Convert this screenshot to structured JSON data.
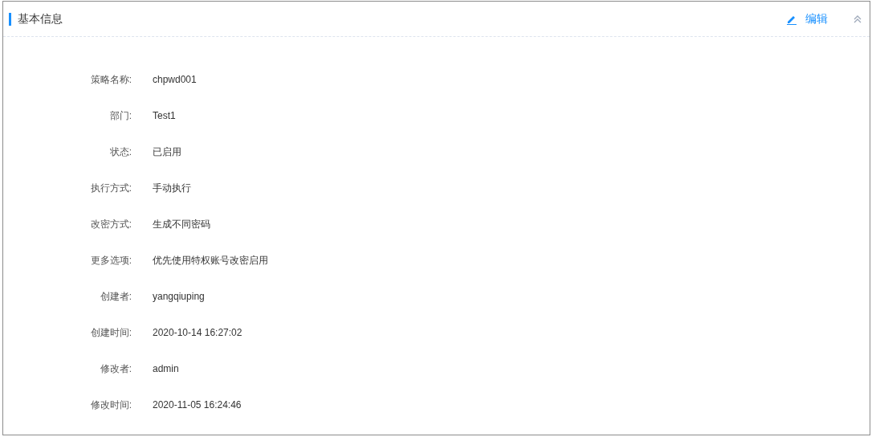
{
  "section": {
    "title": "基本信息",
    "edit_label": "编辑",
    "collapsed": false
  },
  "fields": [
    {
      "label": "策略名称:",
      "value": "chpwd001"
    },
    {
      "label": "部门:",
      "value": "Test1"
    },
    {
      "label": "状态:",
      "value": "已启用"
    },
    {
      "label": "执行方式:",
      "value": "手动执行"
    },
    {
      "label": "改密方式:",
      "value": "生成不同密码"
    },
    {
      "label": "更多选项:",
      "value": "优先使用特权账号改密启用"
    },
    {
      "label": "创建者:",
      "value": "yangqiuping"
    },
    {
      "label": "创建时间:",
      "value": "2020-10-14 16:27:02"
    },
    {
      "label": "修改者:",
      "value": "admin"
    },
    {
      "label": "修改时间:",
      "value": "2020-11-05 16:24:46"
    }
  ]
}
